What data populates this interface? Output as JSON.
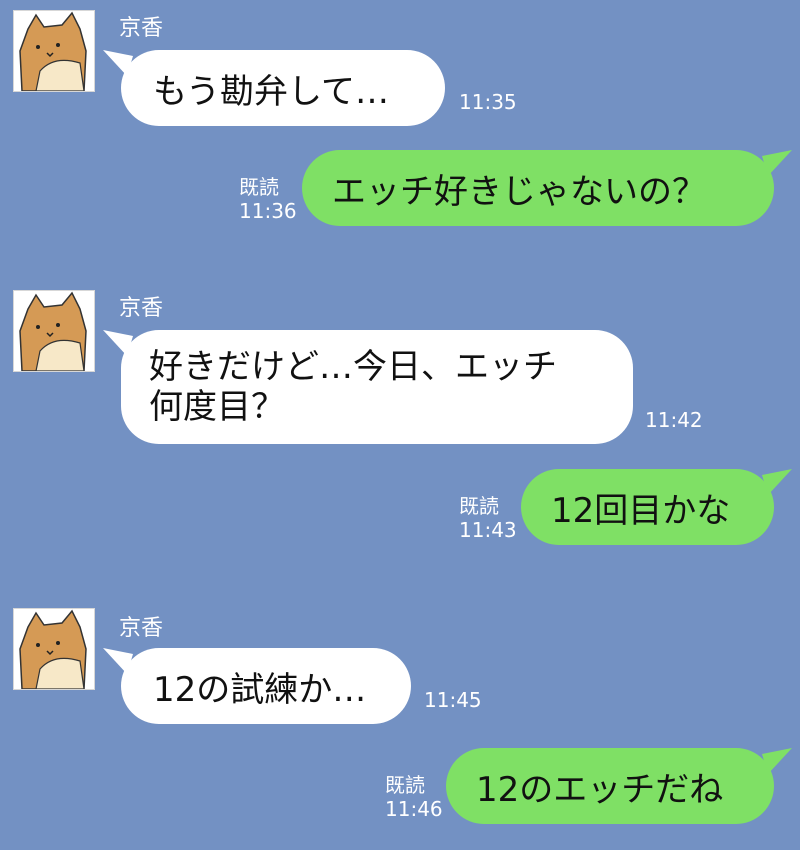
{
  "theme": {
    "background": "#7391c3",
    "incoming_bubble": "#ffffff",
    "outgoing_bubble": "#7fe065"
  },
  "contact": {
    "name": "京香",
    "avatar_icon": "shiba-dog-avatar-icon"
  },
  "messages": [
    {
      "direction": "in",
      "sender": "京香",
      "text": "もう勘弁して…",
      "time": "11:35"
    },
    {
      "direction": "out",
      "read_label": "既読",
      "text": "エッチ好きじゃないの？",
      "time": "11:36"
    },
    {
      "direction": "in",
      "sender": "京香",
      "text_line1": "好きだけど…今日、エッチ",
      "text_line2": "何度目？",
      "time": "11:42"
    },
    {
      "direction": "out",
      "read_label": "既読",
      "text": "12回目かな",
      "time": "11:43"
    },
    {
      "direction": "in",
      "sender": "京香",
      "text": "12の試練か…",
      "time": "11:45"
    },
    {
      "direction": "out",
      "read_label": "既読",
      "text": "12のエッチだね",
      "time": "11:46"
    }
  ]
}
